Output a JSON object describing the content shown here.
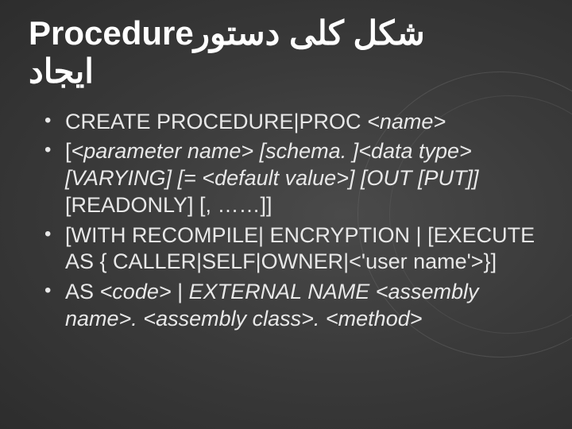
{
  "title": {
    "line1_left": "Procedure",
    "line1_right": "شکل کلی دستور",
    "line2": "ایجاد"
  },
  "bullets": [
    {
      "segments": [
        {
          "text": "CREATE PROCEDURE|PROC ",
          "italic": false
        },
        {
          "text": "<name>",
          "italic": true
        }
      ]
    },
    {
      "segments": [
        {
          "text": "[",
          "italic": false
        },
        {
          "text": "<parameter name> [schema. ]<data type> [VARYING] [= <default value>] [OUT [PUT]] ",
          "italic": true
        },
        {
          "text": "[READONLY] [, ……]]",
          "italic": false
        }
      ]
    },
    {
      "segments": [
        {
          "text": "[WITH RECOMPILE| ENCRYPTION | [EXECUTE AS { CALLER|SELF|OWNER|<'user name'>}]",
          "italic": false
        }
      ]
    },
    {
      "segments": [
        {
          "text": "AS ",
          "italic": false
        },
        {
          "text": "<code>",
          "italic": true
        },
        {
          "text": " | ",
          "italic": false
        },
        {
          "text": "EXTERNAL NAME <assembly name>. <assembly class>. <method>",
          "italic": true
        }
      ]
    }
  ]
}
